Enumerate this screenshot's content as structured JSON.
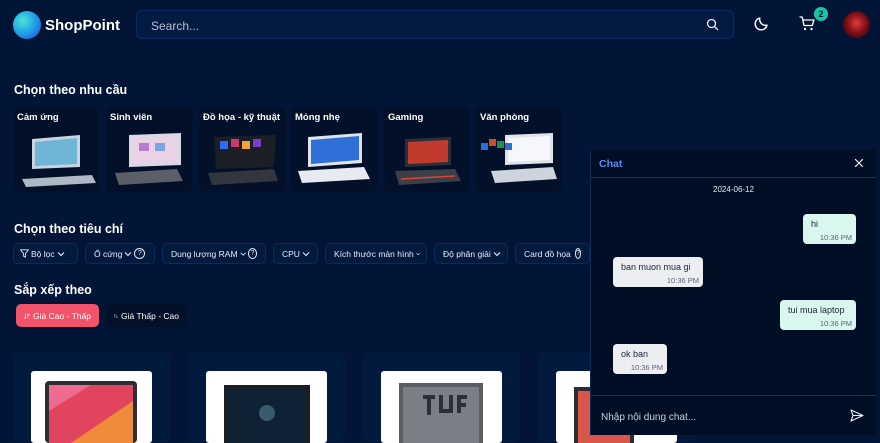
{
  "header": {
    "logo_text": "ShopPoint",
    "search_placeholder": "Search...",
    "cart_count": "2"
  },
  "needs": {
    "title": "Chọn theo nhu cầu",
    "items": [
      {
        "label": "Cảm ứng"
      },
      {
        "label": "Sinh viên"
      },
      {
        "label": "Đồ họa - kỹ thuật"
      },
      {
        "label": "Mỏng nhẹ"
      },
      {
        "label": "Gaming"
      },
      {
        "label": "Văn phòng"
      }
    ]
  },
  "criteria": {
    "title": "Chọn theo tiêu chí",
    "filters": [
      {
        "label": "Bộ lọc"
      },
      {
        "label": "Ổ cứng"
      },
      {
        "label": "Dung lượng RAM"
      },
      {
        "label": "CPU"
      },
      {
        "label": "Kích thước màn hình"
      },
      {
        "label": "Độ phân giải"
      },
      {
        "label": "Card đồ họa"
      }
    ]
  },
  "sort": {
    "title": "Sắp xếp theo",
    "high_low": "Giá Cao - Thấp",
    "low_high": "Giá Thấp - Cao"
  },
  "chat": {
    "title": "Chat",
    "date": "2024-06-12",
    "messages": [
      {
        "text": "hi",
        "time": "10:36 PM",
        "side": "out"
      },
      {
        "text": "ban muon mua gi",
        "time": "10:36 PM",
        "side": "in"
      },
      {
        "text": "tui mua laptop",
        "time": "10:36 PM",
        "side": "out"
      },
      {
        "text": "ok ban",
        "time": "10:36 PM",
        "side": "in"
      }
    ],
    "input_placeholder": "Nhập nội dung chat..."
  },
  "colors": {
    "background": "#021536",
    "accent": "#f0536a",
    "chat_title": "#5b8df5",
    "badge": "#18c6a6"
  }
}
